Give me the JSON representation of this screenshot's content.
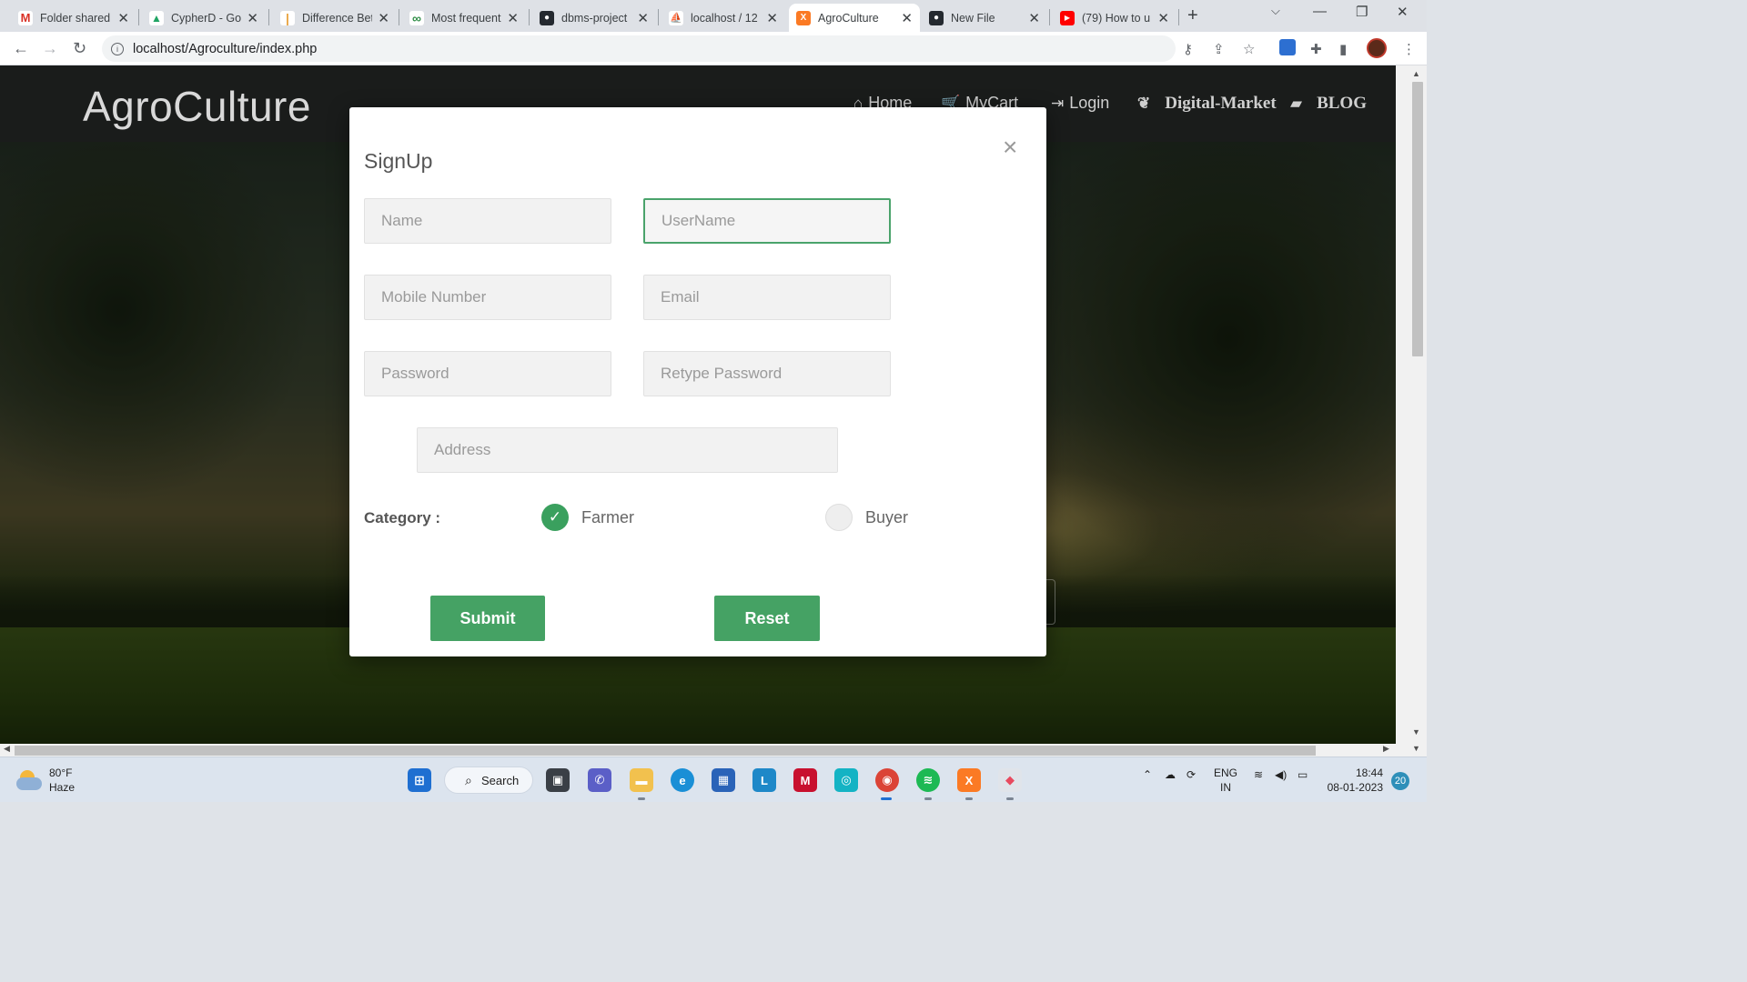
{
  "browser": {
    "tabs": [
      {
        "title": "Folder shared",
        "icon": "gmail-icon",
        "color": "#d93025",
        "glyph": "M"
      },
      {
        "title": "CypherD - Go",
        "icon": "google-drive-icon",
        "color": "#1fa463",
        "glyph": "▲"
      },
      {
        "title": "Difference Bet",
        "icon": "document-icon",
        "color": "#e8a33d",
        "glyph": "|"
      },
      {
        "title": "Most frequent",
        "icon": "geeksforgeeks-icon",
        "color": "#2f8d46",
        "glyph": "∞"
      },
      {
        "title": "dbms-project",
        "icon": "github-icon",
        "color": "#24292f",
        "glyph": "●"
      },
      {
        "title": "localhost / 12",
        "icon": "phpmyadmin-icon",
        "color": "#f29111",
        "glyph": "⛵"
      },
      {
        "title": "AgroCulture",
        "icon": "xampp-icon",
        "color": "#fb7a24",
        "glyph": "X"
      },
      {
        "title": "New File",
        "icon": "github-icon",
        "color": "#24292f",
        "glyph": "●"
      },
      {
        "title": "(79) How to u",
        "icon": "youtube-icon",
        "color": "#ff0000",
        "glyph": "▶"
      }
    ],
    "active_tab_index": 6,
    "url": "localhost/Agroculture/index.php"
  },
  "site": {
    "brand": "AgroCulture",
    "nav": {
      "home": "Home",
      "cart": "MyCart",
      "login": "Login",
      "market": "Digital-Market",
      "blog": "BLOG"
    }
  },
  "modal": {
    "title": "SignUp",
    "close": "×",
    "fields": {
      "name": "Name",
      "username": "UserName",
      "mobile": "Mobile Number",
      "email": "Email",
      "password": "Password",
      "retype": "Retype Password",
      "address": "Address"
    },
    "category_label": "Category :",
    "category_options": [
      {
        "label": "Farmer",
        "selected": true
      },
      {
        "label": "Buyer",
        "selected": false
      }
    ],
    "submit": "Submit",
    "reset": "Reset",
    "accent_color": "#45a264"
  },
  "taskbar": {
    "weather_temp": "80°F",
    "weather_desc": "Haze",
    "search": "Search",
    "lang_top": "ENG",
    "lang_bottom": "IN",
    "time": "18:44",
    "date": "08-01-2023",
    "notifications": "20"
  }
}
